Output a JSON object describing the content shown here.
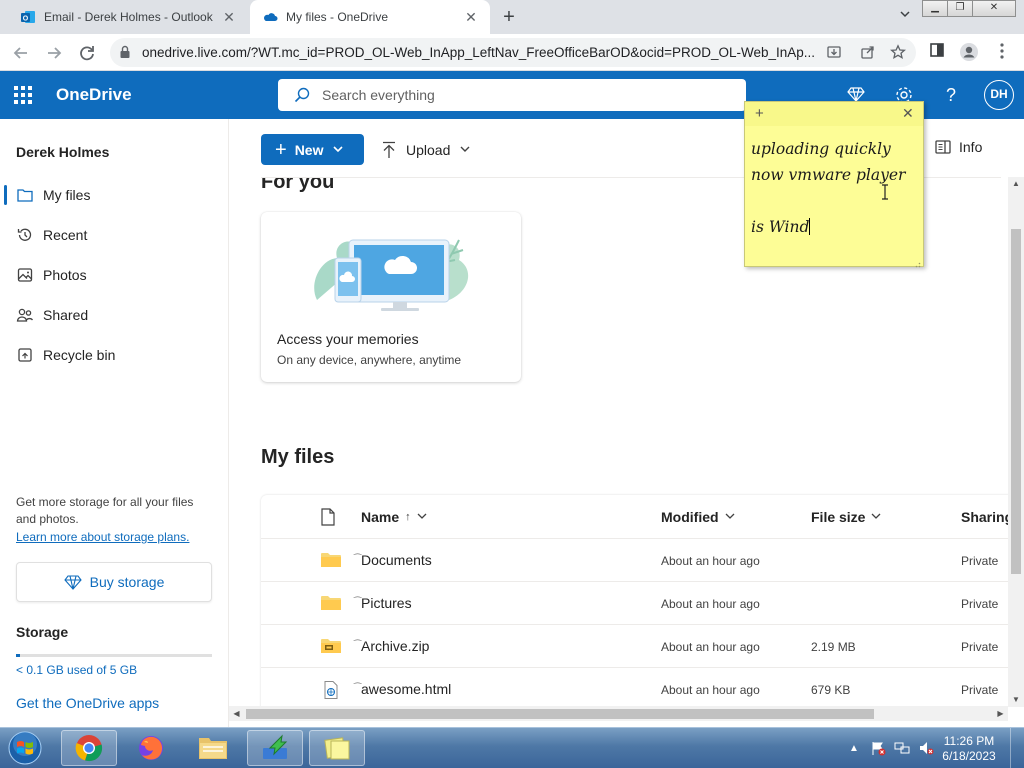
{
  "browser": {
    "tabs": [
      {
        "title": "Email - Derek Holmes - Outlook",
        "close": "✕"
      },
      {
        "title": "My files - OneDrive",
        "close": "✕"
      }
    ],
    "new_tab": "+",
    "window_buttons": {
      "minimize": "▁",
      "maximize": "❐",
      "close": "✕"
    },
    "url": "onedrive.live.com/?WT.mc_id=PROD_OL-Web_InApp_LeftNav_FreeOfficeBarOD&ocid=PROD_OL-Web_InAp..."
  },
  "header": {
    "brand": "OneDrive",
    "search_placeholder": "Search everything",
    "avatar_initials": "DH",
    "help_label": "?"
  },
  "sidebar": {
    "user_name": "Derek Holmes",
    "items": [
      {
        "label": "My files",
        "icon": "folder-icon",
        "selected": true
      },
      {
        "label": "Recent",
        "icon": "history-icon"
      },
      {
        "label": "Photos",
        "icon": "image-icon"
      },
      {
        "label": "Shared",
        "icon": "people-icon"
      },
      {
        "label": "Recycle bin",
        "icon": "recycle-bin-icon"
      }
    ],
    "storage_promo": "Get more storage for all your files and photos.",
    "storage_link": "Learn more about storage plans.",
    "buy_storage": "Buy storage",
    "storage_title": "Storage",
    "storage_used": "< 0.1 GB used of 5 GB",
    "storage_fraction": 0.02,
    "get_apps": "Get the OneDrive apps"
  },
  "toolbar": {
    "new_label": "New",
    "upload_label": "Upload",
    "info_label": "Info"
  },
  "for_you": {
    "title": "For you",
    "card_title": "Access your memories",
    "card_subtitle": "On any device, anywhere, anytime"
  },
  "my_files": {
    "title": "My files",
    "columns": {
      "name": "Name",
      "name_sort": "↑",
      "modified": "Modified",
      "size": "File size",
      "sharing": "Sharing"
    },
    "rows": [
      {
        "name": "Documents",
        "type": "folder",
        "modified": "About an hour ago",
        "size": "",
        "sharing": "Private"
      },
      {
        "name": "Pictures",
        "type": "folder",
        "modified": "About an hour ago",
        "size": "",
        "sharing": "Private"
      },
      {
        "name": "Archive.zip",
        "type": "zip",
        "modified": "About an hour ago",
        "size": "2.19 MB",
        "sharing": "Private"
      },
      {
        "name": "awesome.html",
        "type": "html",
        "modified": "About an hour ago",
        "size": "679 KB",
        "sharing": "Private"
      }
    ]
  },
  "sticky_note": {
    "add": "+",
    "close": "✕",
    "text": "uploading quickly now vmware player\n\nis Wind"
  },
  "taskbar": {
    "time": "11:26 PM",
    "date": "6/18/2023"
  },
  "colors": {
    "accent": "#0f6cbd",
    "sticky": "#fdfd96",
    "tab_strip": "#dee1e6"
  }
}
